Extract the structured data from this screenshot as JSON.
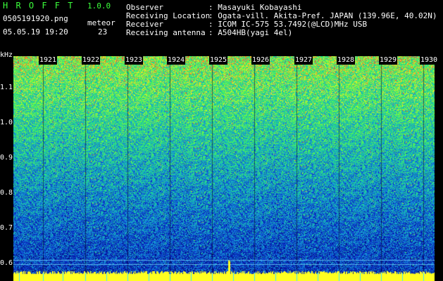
{
  "app": {
    "logo": "H R O F F T",
    "version": "1.0.0",
    "filename": "0505191920.png",
    "datetime": "05.05.19 19:20",
    "meteor_label": "meteor",
    "meteor_count": "23"
  },
  "info": {
    "observer_label": "Observer",
    "observer_value": ": Masayuki Kobayashi",
    "location_label": "Receiving Location",
    "location_value": ": Ogata-vill. Akita-Pref. JAPAN (139.96E, 40.02N)",
    "receiver_label": "Receiver",
    "receiver_value": ": ICOM IC-575 53.7492(@LCD)MHz USB",
    "antenna_label": "Receiving antenna",
    "antenna_value": ": A504HB(yagi 4el)"
  },
  "axis": {
    "unit": "kHz",
    "y_ticks": [
      "1.1",
      "1.0",
      "0.9",
      "0.8",
      "0.7",
      "0.6"
    ],
    "x_ticks": [
      "1921",
      "1922",
      "1923",
      "1924",
      "1925",
      "1926",
      "1927",
      "1928",
      "1929",
      "1930"
    ]
  },
  "colors": {
    "background": "#000000",
    "header_text": "#ffffff",
    "logo_green": "#3cff3c",
    "waterfall_low": "#0a1a9c",
    "waterfall_mid": "#1ea0d8",
    "waterfall_high": "#3cff7a",
    "signal_peak": "#ffff20"
  }
}
